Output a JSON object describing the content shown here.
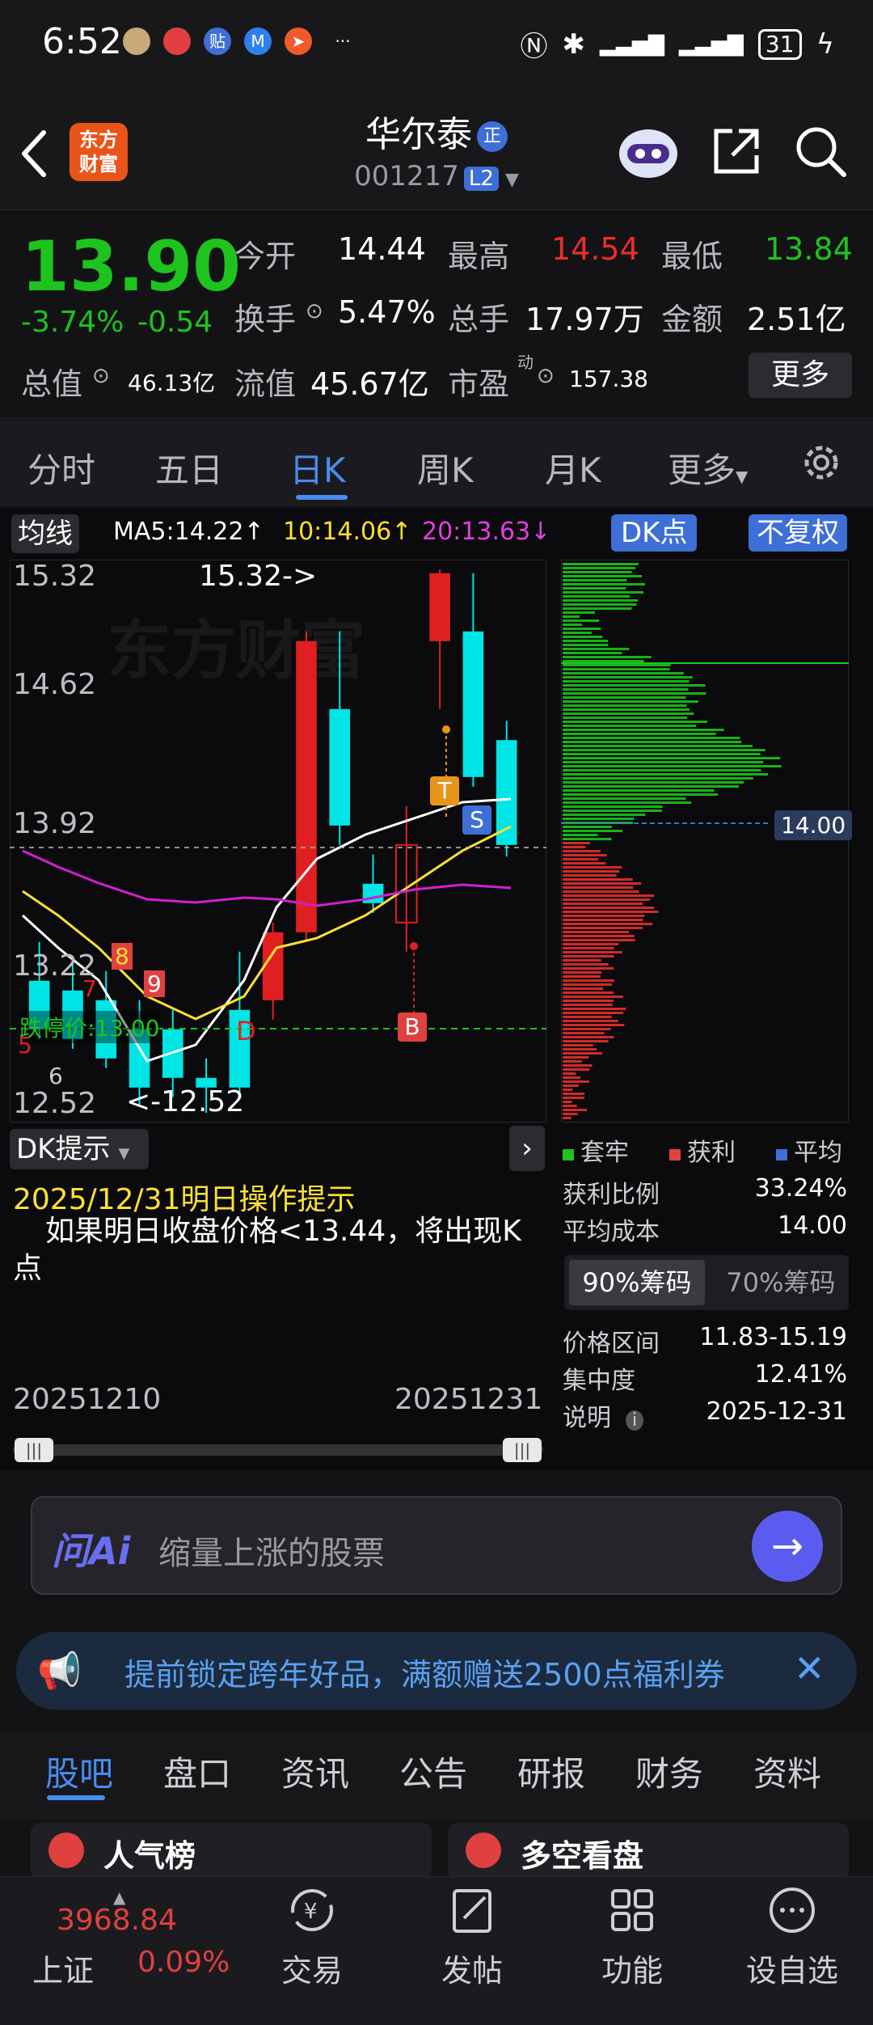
{
  "status_bar": {
    "time": "6:52",
    "app_icons": [
      "贴"
    ],
    "battery": "31",
    "dots": "···"
  },
  "header": {
    "logo_line1": "东方",
    "logo_line2": "财富",
    "stock_name": "华尔泰",
    "badge": "正",
    "code": "001217",
    "level": "L2"
  },
  "quote": {
    "price": "13.90",
    "change_pct": "-3.74%",
    "change": "-0.54",
    "open_label": "今开",
    "open": "14.44",
    "high_label": "最高",
    "high": "14.54",
    "low_label": "最低",
    "low": "13.84",
    "turnover_label": "换手",
    "turnover": "5.47%",
    "volume_label": "总手",
    "volume": "17.97万",
    "amount_label": "金额",
    "amount": "2.51亿",
    "mktcap_label": "总值",
    "mktcap": "46.13亿",
    "float_label": "流值",
    "float": "45.67亿",
    "pe_label": "市盈",
    "pe_sup": "动",
    "pe": "157.38",
    "more": "更多"
  },
  "tabs": [
    "分时",
    "五日",
    "日K",
    "周K",
    "月K",
    "更多"
  ],
  "chart": {
    "ma_label": "均线",
    "ma5": "MA5:14.22↑",
    "ma10": "10:14.06↑",
    "ma20": "20:13.63↓",
    "dk_label": "DK点",
    "fq_label": "不复权",
    "y_ticks": [
      "15.32",
      "14.62",
      "13.92",
      "13.22",
      "12.52"
    ],
    "high_mark": "15.32->",
    "low_mark": "<-12.52",
    "limit_down": "跌停价:13.00",
    "markers": {
      "t": "T",
      "s": "S",
      "b": "B",
      "d": "D",
      "n8": "8",
      "n9": "9",
      "n7": "7",
      "n5": "5",
      "n6": "6"
    },
    "avg_tag": "14.00",
    "date_start": "20251210",
    "date_end": "20251231",
    "colors": {
      "up": "#e02020",
      "down": "#00e5e5",
      "ma5": "#ffffff",
      "ma10": "#ffe033",
      "ma20": "#d020d0"
    }
  },
  "chart_data": {
    "type": "candlestick",
    "candles": [
      {
        "o": 13.2,
        "h": 13.4,
        "l": 12.9,
        "c": 12.95,
        "dir": "down"
      },
      {
        "o": 13.15,
        "h": 13.3,
        "l": 12.85,
        "c": 12.9,
        "dir": "down"
      },
      {
        "o": 13.1,
        "h": 13.25,
        "l": 12.75,
        "c": 12.8,
        "dir": "down"
      },
      {
        "o": 12.95,
        "h": 13.1,
        "l": 12.55,
        "c": 12.65,
        "dir": "down"
      },
      {
        "o": 12.95,
        "h": 13.05,
        "l": 12.6,
        "c": 12.7,
        "dir": "down"
      },
      {
        "o": 12.7,
        "h": 12.8,
        "l": 12.52,
        "c": 12.65,
        "dir": "down"
      },
      {
        "o": 12.65,
        "h": 13.35,
        "l": 12.6,
        "c": 13.05,
        "dir": "down"
      },
      {
        "o": 13.1,
        "h": 13.5,
        "l": 13.0,
        "c": 13.45,
        "dir": "up"
      },
      {
        "o": 13.45,
        "h": 15.0,
        "l": 13.4,
        "c": 14.95,
        "dir": "up"
      },
      {
        "o": 14.6,
        "h": 15.0,
        "l": 13.9,
        "c": 14.0,
        "dir": "down"
      },
      {
        "o": 13.7,
        "h": 13.85,
        "l": 13.55,
        "c": 13.6,
        "dir": "down"
      },
      {
        "o": 13.5,
        "h": 14.1,
        "l": 13.35,
        "c": 13.9,
        "dir": "up"
      },
      {
        "o": 14.95,
        "h": 15.32,
        "l": 14.6,
        "c": 15.3,
        "dir": "up"
      },
      {
        "o": 15.0,
        "h": 15.3,
        "l": 14.2,
        "c": 14.25,
        "dir": "down"
      },
      {
        "o": 14.44,
        "h": 14.54,
        "l": 13.84,
        "c": 13.9,
        "dir": "down"
      }
    ],
    "ylim": [
      12.52,
      15.32
    ]
  },
  "dk": {
    "title": "DK提示",
    "line1": "2025/12/31明日操作提示",
    "line2": "如果明日收盘价格<13.44，将出现K点"
  },
  "chips": {
    "legend": [
      "套牢",
      "获利",
      "平均"
    ],
    "profit_label": "获利比例",
    "profit": "33.24%",
    "avg_label": "平均成本",
    "avg": "14.00",
    "seg_on": "90%筹码",
    "seg_off": "70%筹码",
    "range_label": "价格区间",
    "range": "11.83-15.19",
    "conc_label": "集中度",
    "conc": "12.41%",
    "note_label": "说明",
    "note_date": "2025-12-31"
  },
  "ai": {
    "logo": "问Ai",
    "placeholder": "缩量上涨的股票"
  },
  "banner": {
    "text": "提前锁定跨年好品，满额赠送2500点福利券"
  },
  "bottom_tabs": [
    "股吧",
    "盘口",
    "资讯",
    "公告",
    "研报",
    "财务",
    "资料"
  ],
  "cards": {
    "left": "人气榜",
    "right": "多空看盘"
  },
  "nav": {
    "index_name": "上证",
    "index_value": "3968.84",
    "index_pct": "0.09%",
    "items": [
      "交易",
      "发帖",
      "功能",
      "设自选"
    ]
  }
}
